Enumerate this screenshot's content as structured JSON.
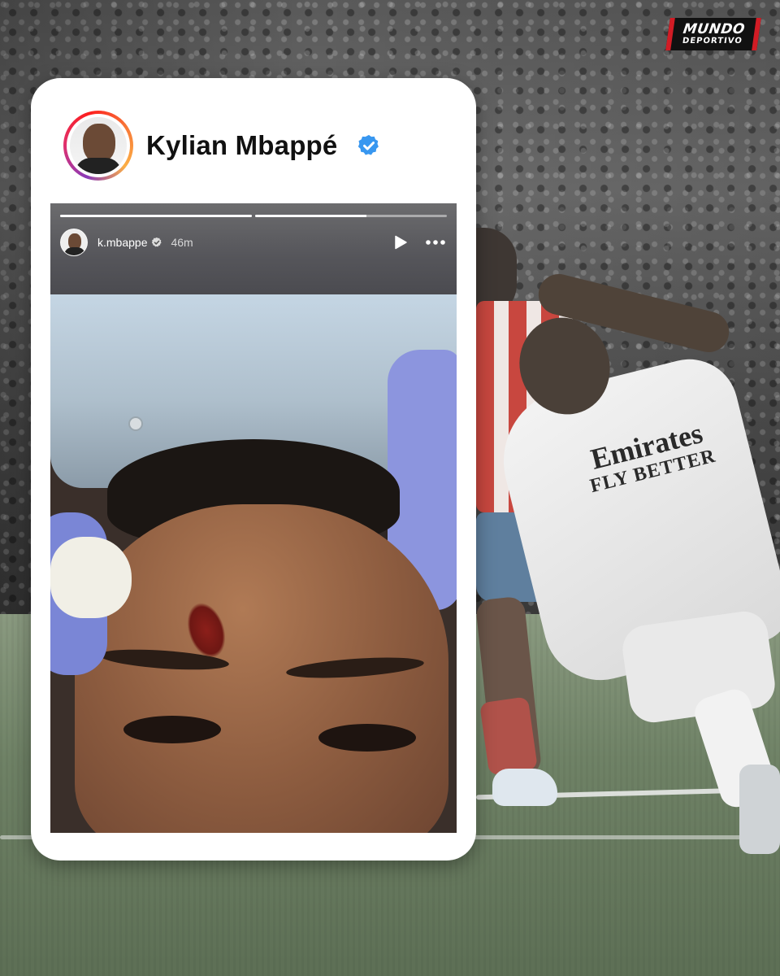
{
  "brand": {
    "line1": "MUNDO",
    "line2": "DEPORTIVO",
    "color": "#d21c25"
  },
  "background": {
    "sponsor_line1": "Emirates",
    "sponsor_line2": "FLY BETTER"
  },
  "profile": {
    "display_name": "Kylian Mbappé",
    "verified": true,
    "avatar_ring_colors": [
      "#8a3ab9",
      "#e1306c",
      "#fd1d1d",
      "#f77737",
      "#fcaf45"
    ],
    "verified_color": "#3897f0"
  },
  "story": {
    "username": "k.mbappe",
    "time_ago": "46m",
    "progress": [
      1.0,
      0.58
    ],
    "icons": {
      "avatar": "avatar",
      "verified": "verified-badge-icon",
      "play": "play-icon",
      "more": "more-options-icon"
    }
  }
}
